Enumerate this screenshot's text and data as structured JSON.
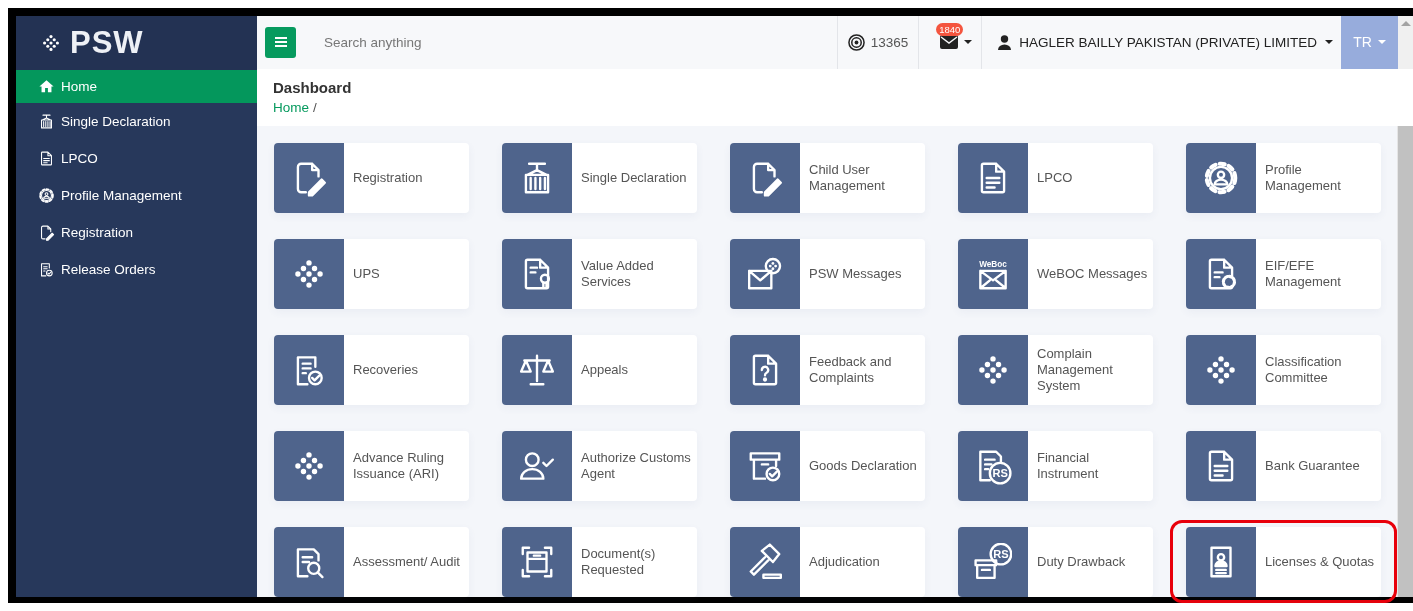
{
  "sidebar": {
    "logo": "PSW",
    "items": [
      {
        "label": "Home",
        "kind": "home",
        "selected": true
      },
      {
        "label": "Single Declaration",
        "kind": "container",
        "selected": false
      },
      {
        "label": "LPCO",
        "kind": "doc",
        "selected": false
      },
      {
        "label": "Profile Management",
        "kind": "gear-person",
        "selected": false
      },
      {
        "label": "Registration",
        "kind": "doc-pen",
        "selected": false
      },
      {
        "label": "Release Orders",
        "kind": "doc-check",
        "selected": false
      }
    ]
  },
  "topbar": {
    "search": {
      "placeholder": "Search anything"
    },
    "points": "13365",
    "messages_badge": "1840",
    "user": "HAGLER BAILLY PAKISTAN (PRIVATE) LIMITED",
    "language": "TR"
  },
  "header": {
    "title": "Dashboard",
    "breadcrumb": {
      "link": "Home",
      "separator": "/"
    }
  },
  "tiles": [
    {
      "label": "Registration",
      "kind": "doc-pen",
      "highlighted": false
    },
    {
      "label": "Single Declaration",
      "kind": "container",
      "highlighted": false
    },
    {
      "label": "Child User Management",
      "kind": "doc-pen",
      "highlighted": false
    },
    {
      "label": "LPCO",
      "kind": "doc",
      "highlighted": false
    },
    {
      "label": "Profile Management",
      "kind": "gear-person",
      "highlighted": false
    },
    {
      "label": "UPS",
      "kind": "dots",
      "highlighted": false
    },
    {
      "label": "Value Added Services",
      "kind": "doc-seal",
      "highlighted": false
    },
    {
      "label": "PSW Messages",
      "kind": "envelope-dots",
      "highlighted": false
    },
    {
      "label": "WeBOC Messages",
      "kind": "envelope-label",
      "icon_text": "WeBoc",
      "highlighted": false
    },
    {
      "label": "EIF/EFE Management",
      "kind": "doc-gear",
      "highlighted": false
    },
    {
      "label": "Recoveries",
      "kind": "doc-check",
      "highlighted": false
    },
    {
      "label": "Appeals",
      "kind": "scales",
      "highlighted": false
    },
    {
      "label": "Feedback and Complaints",
      "kind": "doc-question",
      "highlighted": false
    },
    {
      "label": "Complain Management System",
      "kind": "dots",
      "highlighted": false
    },
    {
      "label": "Classification Committee",
      "kind": "dots",
      "highlighted": false
    },
    {
      "label": "Advance Ruling Issuance (ARI)",
      "kind": "dots",
      "highlighted": false
    },
    {
      "label": "Authorize Customs Agent",
      "kind": "person-check",
      "highlighted": false
    },
    {
      "label": "Goods Declaration",
      "kind": "box-check",
      "highlighted": false
    },
    {
      "label": "Financial Instrument",
      "kind": "doc-badge",
      "icon_text": "RS",
      "highlighted": false
    },
    {
      "label": "Bank Guarantee",
      "kind": "doc",
      "highlighted": false
    },
    {
      "label": "Assessment/ Audit",
      "kind": "doc-search",
      "highlighted": false
    },
    {
      "label": "Document(s) Requested",
      "kind": "frame-box",
      "highlighted": false
    },
    {
      "label": "Adjudication",
      "kind": "gavel",
      "highlighted": false
    },
    {
      "label": "Duty Drawback",
      "kind": "box-badge",
      "icon_text": "RS",
      "highlighted": false
    },
    {
      "label": "Licenses & Quotas",
      "kind": "id-card",
      "highlighted": true
    }
  ]
}
